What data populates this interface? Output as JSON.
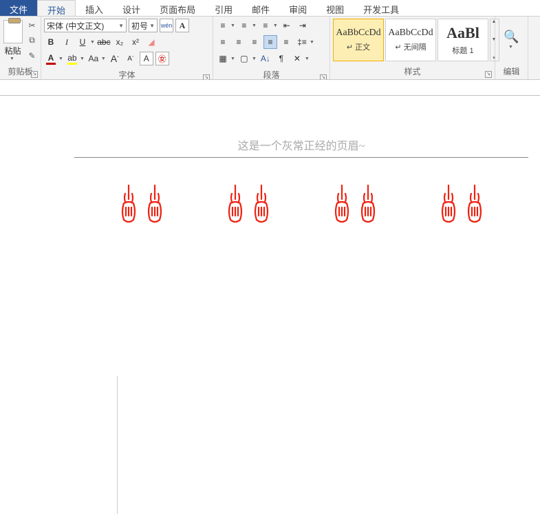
{
  "tabs": {
    "file": "文件",
    "home": "开始",
    "insert": "插入",
    "design": "设计",
    "layout": "页面布局",
    "references": "引用",
    "mail": "邮件",
    "review": "审阅",
    "view": "视图",
    "dev": "开发工具"
  },
  "clipboard": {
    "paste": "粘贴",
    "label": "剪贴板"
  },
  "font": {
    "name": "宋体 (中文正文)",
    "size": "初号",
    "wen": "wén",
    "label": "字体",
    "b": "B",
    "i": "I",
    "u": "U",
    "s": "abc",
    "x2": "x₂",
    "x2s": "x²",
    "a_big": "A",
    "a_small": "A",
    "aa": "Aa",
    "a_char": "A",
    "a_color": "#c00000",
    "hl_color": "#ffff00",
    "grow": "A",
    "shrink": "A"
  },
  "para": {
    "label": "段落"
  },
  "styles": {
    "label": "样式",
    "preview": "AaBbCcDd",
    "normal": "↵ 正文",
    "nospace": "↵ 无间隔",
    "h1": "标题 1",
    "h1prev": "AaBl"
  },
  "edit": {
    "label": "编辑"
  },
  "doc": {
    "header": "这是一个灰常正经的页眉~"
  }
}
